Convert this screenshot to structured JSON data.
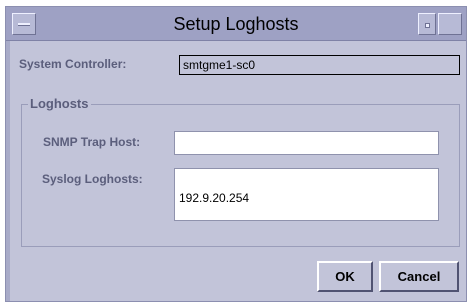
{
  "window": {
    "title": "Setup Loghosts"
  },
  "system_controller": {
    "label": "System Controller:",
    "value": "smtgme1-sc0"
  },
  "loghosts_group": {
    "legend": "Loghosts",
    "snmp_trap_host": {
      "label": "SNMP Trap Host:",
      "value": ""
    },
    "syslog_loghosts": {
      "label": "Syslog Loghosts:",
      "value": "192.9.20.254"
    }
  },
  "buttons": {
    "ok": "OK",
    "cancel": "Cancel"
  }
}
